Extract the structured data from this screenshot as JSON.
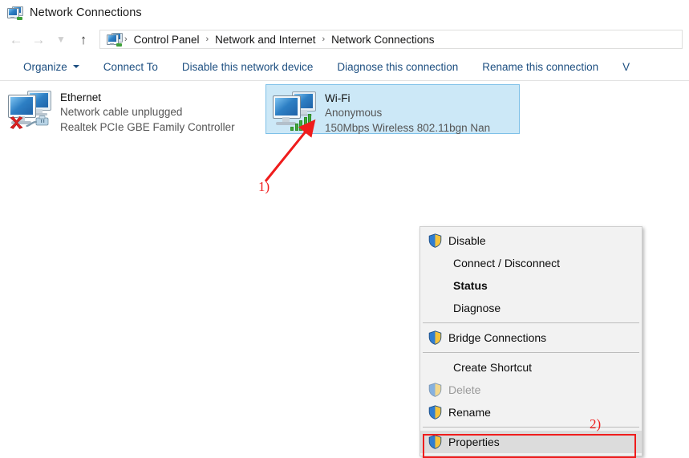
{
  "window": {
    "title": "Network Connections",
    "title_icon": "network-connections-icon"
  },
  "navbar": {
    "back_icon": "arrow-left-icon",
    "forward_icon": "arrow-right-icon",
    "history_icon": "chevron-down-icon",
    "up_icon": "arrow-up-icon",
    "address_icon": "network-connections-icon",
    "breadcrumbs": [
      {
        "label": "Control Panel"
      },
      {
        "label": "Network and Internet"
      },
      {
        "label": "Network Connections"
      }
    ],
    "separator": "›"
  },
  "toolbar": {
    "items": [
      {
        "label": "Organize",
        "has_caret": true
      },
      {
        "label": "Connect To",
        "has_caret": false
      },
      {
        "label": "Disable this network device",
        "has_caret": false
      },
      {
        "label": "Diagnose this connection",
        "has_caret": false
      },
      {
        "label": "Rename this connection",
        "has_caret": false
      },
      {
        "label": "V",
        "has_caret": false
      }
    ]
  },
  "connections": [
    {
      "name": "Ethernet",
      "status": "Network cable unplugged",
      "adapter": "Realtek PCIe GBE Family Controller",
      "icon": "network-computers-icon",
      "overlay": "red-x-unplugged-cable",
      "selected": false
    },
    {
      "name": "Wi-Fi",
      "status": "Anonymous",
      "adapter": "150Mbps Wireless 802.11bgn Nan",
      "icon": "network-computers-icon",
      "overlay": "wifi-signal-bars",
      "selected": true
    }
  ],
  "context_menu": {
    "items": [
      {
        "label": "Disable",
        "mnemonic": "b",
        "shield": true,
        "bold": false,
        "disabled": false,
        "highlighted": false
      },
      {
        "label": "Connect / Disconnect",
        "mnemonic": "o",
        "shield": false,
        "bold": false,
        "disabled": false,
        "highlighted": false
      },
      {
        "label": "Status",
        "mnemonic": "u",
        "shield": false,
        "bold": true,
        "disabled": false,
        "highlighted": false
      },
      {
        "label": "Diagnose",
        "mnemonic": "i",
        "shield": false,
        "bold": false,
        "disabled": false,
        "highlighted": false
      },
      {
        "separator": true
      },
      {
        "label": "Bridge Connections",
        "mnemonic": "g",
        "shield": true,
        "bold": false,
        "disabled": false,
        "highlighted": false
      },
      {
        "separator": true
      },
      {
        "label": "Create Shortcut",
        "mnemonic": "S",
        "shield": false,
        "bold": false,
        "disabled": false,
        "highlighted": false
      },
      {
        "label": "Delete",
        "mnemonic": "D",
        "shield": true,
        "bold": false,
        "disabled": true,
        "highlighted": false
      },
      {
        "label": "Rename",
        "mnemonic": "m",
        "shield": true,
        "bold": false,
        "disabled": false,
        "highlighted": false
      },
      {
        "separator": true
      },
      {
        "label": "Properties",
        "mnemonic": "r",
        "shield": true,
        "bold": false,
        "disabled": false,
        "highlighted": true
      }
    ]
  },
  "annotations": {
    "step1": "1)",
    "step2": "2)",
    "color": "#ef1c1c"
  },
  "colors": {
    "toolbar_link": "#1d4f81",
    "selection_bg": "#cce8f7",
    "selection_border": "#7ec0e8",
    "menu_bg": "#f2f2f2",
    "menu_hover": "#dcdcdc",
    "wifi_green": "#3faa38",
    "annotation_red": "#ef1c1c"
  }
}
